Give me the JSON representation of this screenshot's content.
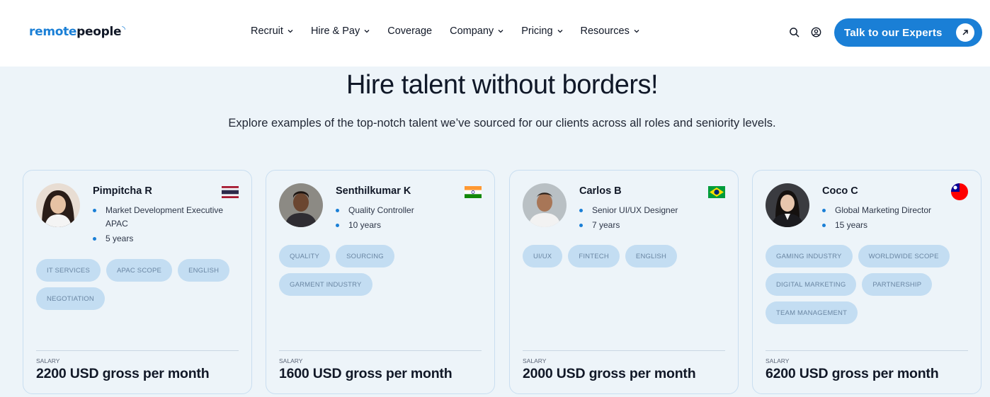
{
  "brand": {
    "part1": "remote",
    "part2": "people",
    "accent": "#1a7fd6"
  },
  "nav": [
    {
      "label": "Recruit",
      "dropdown": true
    },
    {
      "label": "Hire & Pay",
      "dropdown": true
    },
    {
      "label": "Coverage",
      "dropdown": false
    },
    {
      "label": "Company",
      "dropdown": true
    },
    {
      "label": "Pricing",
      "dropdown": true
    },
    {
      "label": "Resources",
      "dropdown": true
    }
  ],
  "header_icons": {
    "search": "search-icon",
    "account": "account-icon"
  },
  "cta": {
    "label": "Talk to our Experts",
    "icon": "arrow-up-right-icon"
  },
  "hero": {
    "title": "Hire talent without borders!",
    "subtitle": "Explore examples of the top-notch talent we’ve sourced for our clients across all roles and seniority levels."
  },
  "salary_label": "SALARY",
  "cards": [
    {
      "name": "Pimpitcha R",
      "flag": "thailand-flag",
      "role": "Market Development Executive APAC",
      "experience": "5 years",
      "tags": [
        "IT SERVICES",
        "APAC SCOPE",
        "ENGLISH",
        "NEGOTIATION"
      ],
      "salary": "2200 USD gross per month"
    },
    {
      "name": "Senthilkumar K",
      "flag": "india-flag",
      "role": "Quality Controller",
      "experience": "10 years",
      "tags": [
        "QUALITY",
        "SOURCING",
        "GARMENT INDUSTRY"
      ],
      "salary": "1600 USD gross per month"
    },
    {
      "name": "Carlos B",
      "flag": "brazil-flag",
      "role": "Senior UI/UX Designer",
      "experience": "7 years",
      "tags": [
        "UI/UX",
        "FINTECH",
        "ENGLISH"
      ],
      "salary": "2000 USD gross per month"
    },
    {
      "name": "Coco C",
      "flag": "taiwan-flag",
      "role": "Global Marketing Director",
      "experience": "15 years",
      "tags": [
        "GAMING INDUSTRY",
        "WORLDWIDE SCOPE",
        "DIGITAL MARKETING",
        "PARTNERSHIP",
        "TEAM MANAGEMENT"
      ],
      "salary": "6200 USD gross per month"
    }
  ]
}
